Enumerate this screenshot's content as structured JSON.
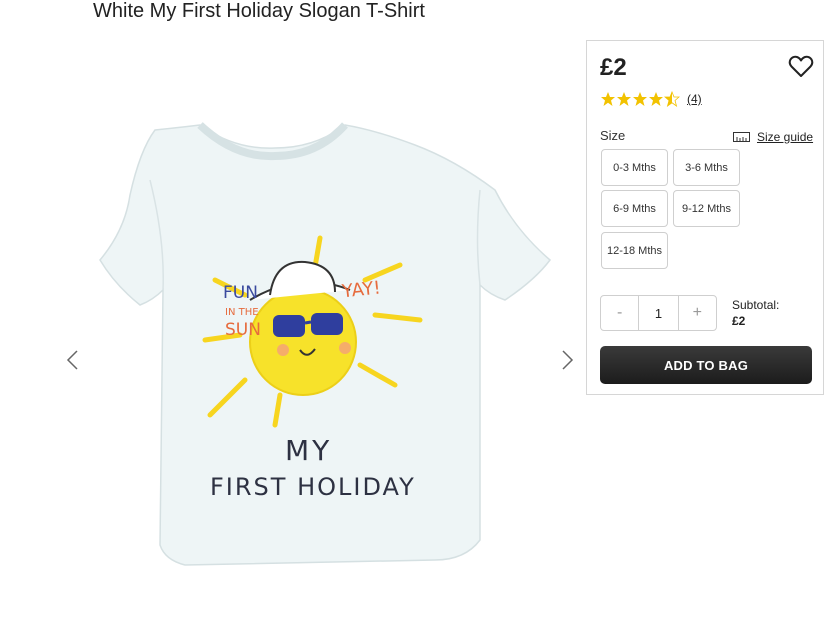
{
  "product": {
    "title": "White My First Holiday Slogan T-Shirt",
    "price": "£2",
    "rating_value": 4.5,
    "rating_max": 5,
    "review_count": "(4)"
  },
  "shirt_print": {
    "fun": "FUN",
    "in_the": "IN THE",
    "sun": "SUN",
    "yay": "YAY!",
    "my": "MY",
    "first_holiday": "FIRST HOLIDAY"
  },
  "icons": {
    "wishlist": "heart-outline-icon",
    "star": "star-icon",
    "size_guide": "ruler-icon",
    "prev": "chevron-left-icon",
    "next": "chevron-right-icon"
  },
  "size": {
    "label": "Size",
    "guide_label": "Size guide",
    "options": [
      "0-3 Mths",
      "3-6 Mths",
      "6-9 Mths",
      "9-12 Mths",
      "12-18 Mths"
    ]
  },
  "quantity": {
    "minus": "-",
    "value": "1",
    "plus": "+"
  },
  "subtotal": {
    "label": "Subtotal:",
    "amount": "£2"
  },
  "cart": {
    "add_label": "ADD TO BAG"
  },
  "colors": {
    "star": "#f2c200",
    "button_bg": "#1f1f1f",
    "sun": "#f7e22a"
  }
}
